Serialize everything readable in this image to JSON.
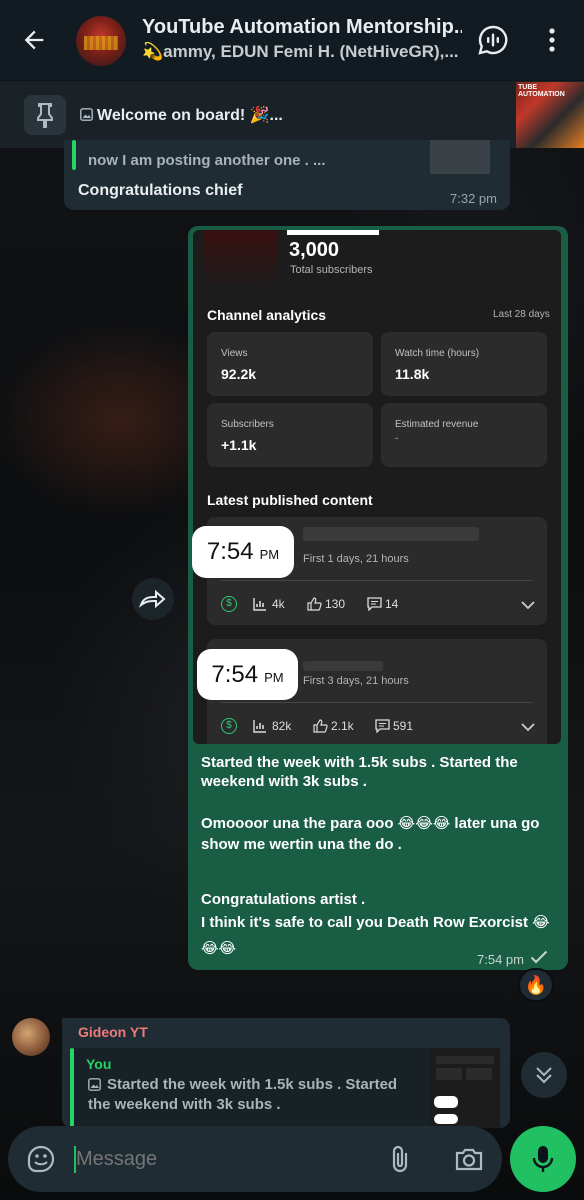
{
  "header": {
    "title": "YouTube Automation Mentorship...",
    "subtitle": "💫ammy, EDUN Femi H. (NetHiveGR),..."
  },
  "pinned": {
    "text": "Welcome on board! 🎉..."
  },
  "prev_message": {
    "quote_text": "now I am posting another one . ...",
    "text": "Congratulations chief",
    "time": "7:32 pm"
  },
  "screenshot": {
    "subscribers": "3,000",
    "subscribers_label": "Total subscribers",
    "analytics_title": "Channel analytics",
    "analytics_period": "Last 28 days",
    "views_label": "Views",
    "views_value": "92.2k",
    "watch_label": "Watch time (hours)",
    "watch_value": "11.8k",
    "subs_label": "Subscribers",
    "subs_value": "+1.1k",
    "revenue_label": "Estimated revenue",
    "revenue_value": "-",
    "latest_title": "Latest published content",
    "item1": {
      "time": "7:54",
      "ampm": "PM",
      "age": "First 1 days, 21 hours",
      "views": "4k",
      "likes": "130",
      "comments": "14"
    },
    "item2": {
      "time": "7:54",
      "ampm": "PM",
      "age": "First 3 days, 21 hours",
      "views": "82k",
      "likes": "2.1k",
      "comments": "591"
    }
  },
  "out_message": {
    "lines": [
      "Started the week with 1.5k subs . Started the",
      "weekend with 3k subs .",
      "Omoooor una the para ooo 😂😂😂 later una go",
      "show me wertin una the do .",
      "Congratulations artist .",
      "I think it's safe to call you Death Row Exorcist 😂",
      "😂😂"
    ],
    "time": "7:54 pm",
    "reaction": "🔥"
  },
  "reply_message": {
    "sender": "Gideon YT",
    "quoted_author": "You",
    "quoted_text_1": "Started the week with 1.5k subs . Started",
    "quoted_text_2": "the weekend with 3k subs ."
  },
  "input": {
    "placeholder": "Message"
  },
  "colors": {
    "header_bg": "#121b22",
    "incoming_bubble": "#1f2c34",
    "outgoing_bubble": "#1a5d45",
    "accent_green": "#21c063",
    "sender_name": "#f07b7b"
  }
}
